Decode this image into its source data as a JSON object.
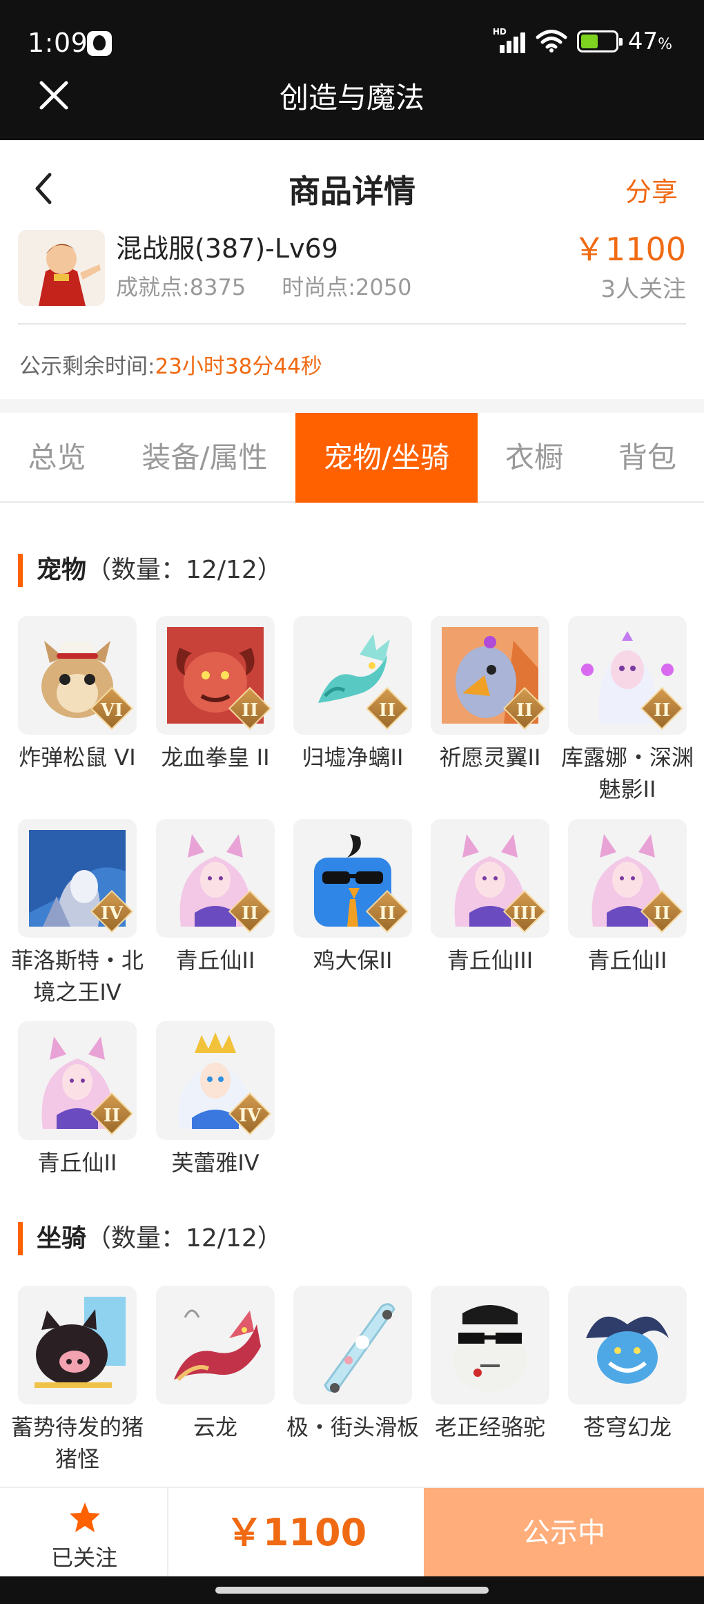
{
  "status_bar": {
    "time": "1:09",
    "signal_label": "HD",
    "battery_percent": "47",
    "battery_unit": "%"
  },
  "app_bar": {
    "title": "创造与魔法"
  },
  "page_header": {
    "title": "商品详情",
    "share_label": "分享"
  },
  "product": {
    "name": "混战服(387)-Lv69",
    "achievement": "成就点:8375",
    "fashion": "时尚点:2050",
    "price": "￥1100",
    "followers": "3人关注"
  },
  "notice": {
    "label": "公示剩余时间:",
    "remaining": "23小时38分44秒"
  },
  "tabs": [
    {
      "label": "总览"
    },
    {
      "label": "装备/属性"
    },
    {
      "label": "宠物/坐骑",
      "active": true
    },
    {
      "label": "衣橱"
    },
    {
      "label": "背包"
    }
  ],
  "pets": {
    "title": "宠物",
    "count": "（数量：12/12）",
    "items": [
      {
        "name": "炸弹松鼠 VI",
        "badge": "VI",
        "icon": "squirrel-icon"
      },
      {
        "name": "龙血拳皇 II",
        "badge": "II",
        "icon": "dragon-brawler-icon"
      },
      {
        "name": "归墟净螭II",
        "badge": "II",
        "icon": "water-dragon-icon"
      },
      {
        "name": "祈愿灵翼II",
        "badge": "II",
        "icon": "griffin-icon"
      },
      {
        "name": "库露娜・深渊魅影II",
        "badge": "II",
        "icon": "abyss-spirit-icon"
      },
      {
        "name": "菲洛斯特・北境之王IV",
        "badge": "IV",
        "icon": "frost-king-icon"
      },
      {
        "name": "青丘仙II",
        "badge": "II",
        "icon": "fox-fairy-icon"
      },
      {
        "name": "鸡大保II",
        "badge": "II",
        "icon": "chicken-icon"
      },
      {
        "name": "青丘仙III",
        "badge": "III",
        "icon": "fox-fairy-icon"
      },
      {
        "name": "青丘仙II",
        "badge": "II",
        "icon": "fox-fairy-icon"
      },
      {
        "name": "青丘仙II",
        "badge": "II",
        "icon": "fox-fairy-icon"
      },
      {
        "name": "芙蕾雅IV",
        "badge": "IV",
        "icon": "goddess-icon"
      }
    ]
  },
  "mounts": {
    "title": "坐骑",
    "count": "（数量：12/12）",
    "items": [
      {
        "name": "蓄势待发的猪猪怪",
        "icon": "pig-icon"
      },
      {
        "name": "云龙",
        "icon": "cloud-dragon-icon"
      },
      {
        "name": "极・街头滑板",
        "icon": "skateboard-icon"
      },
      {
        "name": "老正经骆驼",
        "icon": "camel-icon"
      },
      {
        "name": "苍穹幻龙",
        "icon": "sky-dragon-icon"
      }
    ]
  },
  "bottom_bar": {
    "follow_label": "已关注",
    "price": "￥1100",
    "status": "公示中"
  },
  "colors": {
    "accent": "#ff6000",
    "price": "#f06a13",
    "status_button": "#ffad7a"
  }
}
